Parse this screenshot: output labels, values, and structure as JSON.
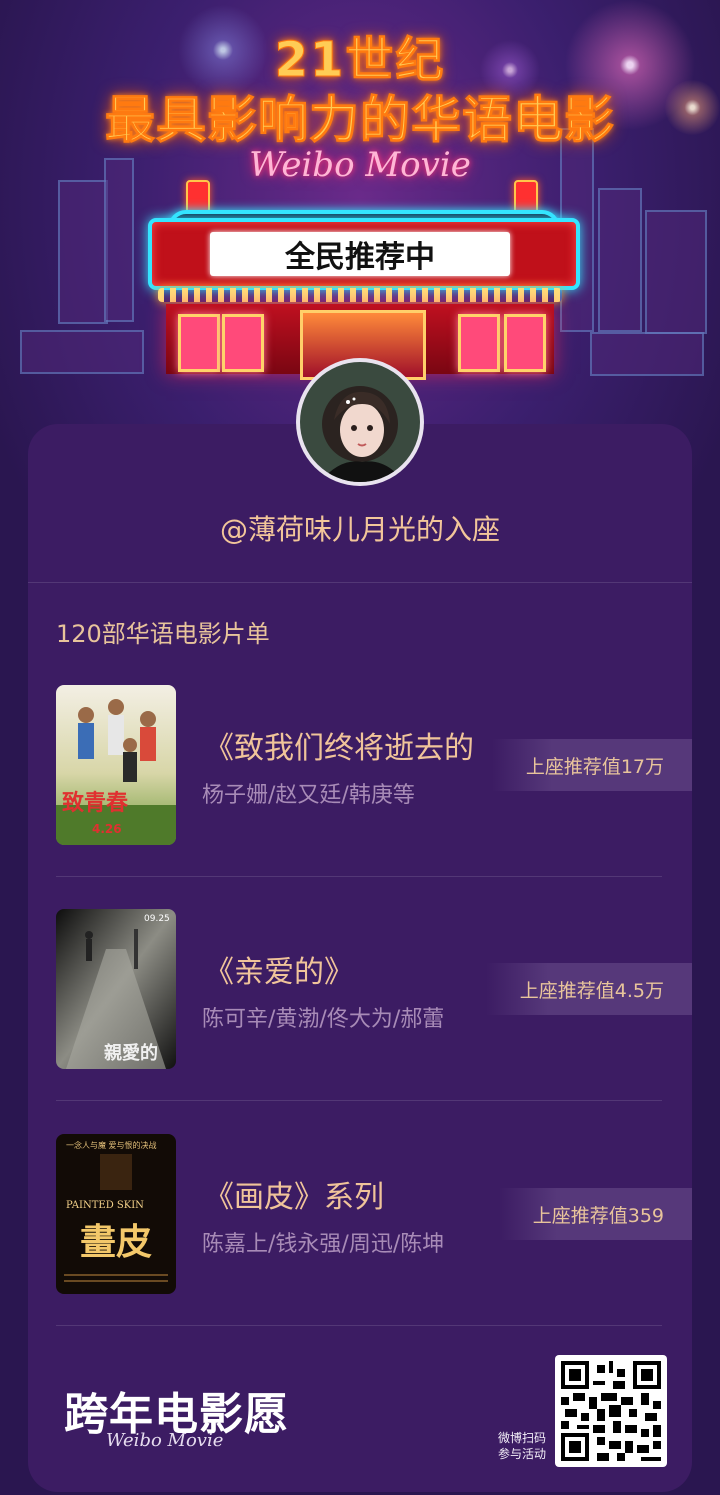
{
  "hero": {
    "title_line1": "21世纪",
    "title_line2": "最具影响力的华语电影",
    "script_brand": "Weibo Movie",
    "marquee_text": "全民推荐中"
  },
  "profile": {
    "handle": "@薄荷味儿月光的入座"
  },
  "list": {
    "title": "120部华语电影片单",
    "items": [
      {
        "title": "《致我们终将逝去的",
        "cast": "杨子姗/赵又廷/韩庚等",
        "badge": "上座推荐值17万",
        "poster_text": "致青春"
      },
      {
        "title": "《亲爱的》",
        "cast": "陈可辛/黄渤/佟大为/郝蕾",
        "badge": "上座推荐值4.5万",
        "poster_text": "親愛的"
      },
      {
        "title": "《画皮》系列",
        "cast": "陈嘉上/钱永强/周迅/陈坤",
        "badge": "上座推荐值359",
        "poster_text": "畫皮",
        "poster_subtitle": "PAINTED SKIN"
      }
    ]
  },
  "footer": {
    "logo": "跨年电影愿",
    "script": "Weibo Movie",
    "qr_caption_line1": "微博扫码",
    "qr_caption_line2": "参与活动"
  },
  "colors": {
    "background": "#2a1650",
    "card": "#3c1c63",
    "accent_gold": "#f0c49a",
    "muted_text": "#a88bb7"
  }
}
